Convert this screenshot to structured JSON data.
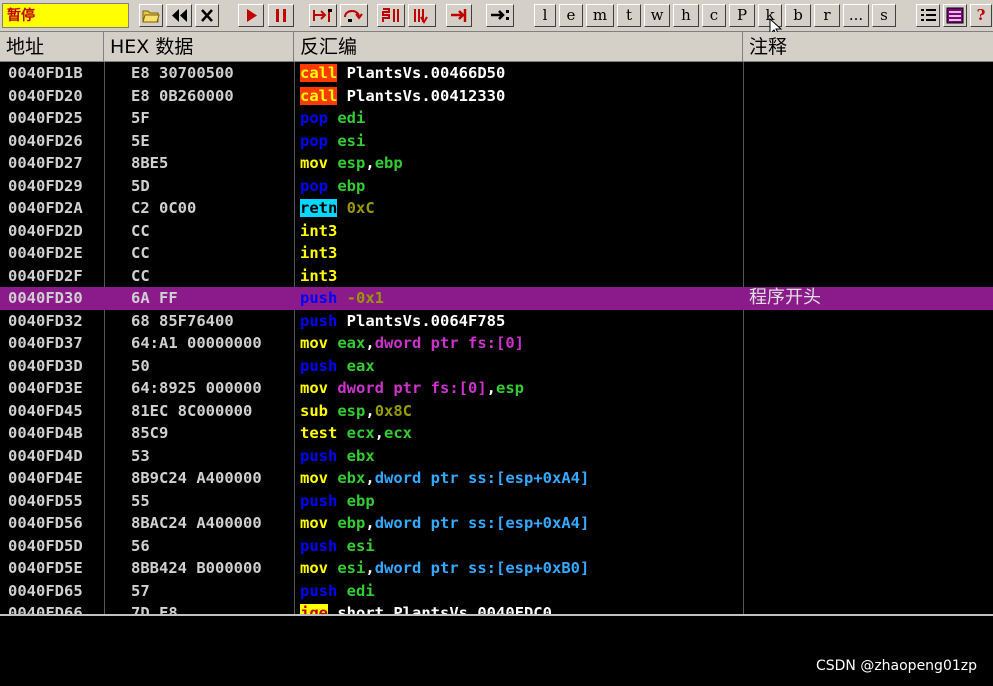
{
  "toolbar": {
    "status": "暂停",
    "letters": [
      "l",
      "e",
      "m",
      "t",
      "w",
      "h",
      "c",
      "P",
      "k",
      "b",
      "r",
      "...",
      "s"
    ],
    "help": "?"
  },
  "columns": {
    "address": "地址",
    "hex": "HEX 数据",
    "disasm": "反汇编",
    "comment": "注释"
  },
  "rows": [
    {
      "addr": "0040FD1B",
      "hex": "E8 30700500",
      "mn": "call",
      "mt": "call",
      "ops": [
        {
          "t": "PlantsVs.00466D50",
          "c": "white"
        }
      ]
    },
    {
      "addr": "0040FD20",
      "hex": "E8 0B260000",
      "mn": "call",
      "mt": "call",
      "ops": [
        {
          "t": "PlantsVs.00412330",
          "c": "white"
        }
      ]
    },
    {
      "addr": "0040FD25",
      "hex": "5F",
      "mn": "pop",
      "mt": "stack",
      "ops": [
        {
          "t": "edi",
          "c": "green"
        }
      ]
    },
    {
      "addr": "0040FD26",
      "hex": "5E",
      "mn": "pop",
      "mt": "stack",
      "ops": [
        {
          "t": "esi",
          "c": "green"
        }
      ]
    },
    {
      "addr": "0040FD27",
      "hex": "8BE5",
      "mn": "mov",
      "mt": "normal",
      "ops": [
        {
          "t": "esp",
          "c": "green"
        },
        {
          "t": ",",
          "c": "white"
        },
        {
          "t": "ebp",
          "c": "green"
        }
      ]
    },
    {
      "addr": "0040FD29",
      "hex": "5D",
      "mn": "pop",
      "mt": "stack",
      "ops": [
        {
          "t": "ebp",
          "c": "green"
        }
      ]
    },
    {
      "addr": "0040FD2A",
      "hex": "C2 0C00",
      "mn": "retn",
      "mt": "retn",
      "ops": [
        {
          "t": "0xC",
          "c": "num"
        }
      ]
    },
    {
      "addr": "0040FD2D",
      "hex": "CC",
      "mn": "int3",
      "mt": "normal",
      "ops": []
    },
    {
      "addr": "0040FD2E",
      "hex": "CC",
      "mn": "int3",
      "mt": "normal",
      "ops": []
    },
    {
      "addr": "0040FD2F",
      "hex": "CC",
      "mn": "int3",
      "mt": "normal",
      "ops": []
    },
    {
      "addr": "0040FD30",
      "hex": "6A FF",
      "mn": "push",
      "mt": "stack",
      "ops": [
        {
          "t": "-0x1",
          "c": "num"
        }
      ],
      "comment": "程序开头",
      "selected": true
    },
    {
      "addr": "0040FD32",
      "hex": "68 85F76400",
      "mn": "push",
      "mt": "stack",
      "ops": [
        {
          "t": "PlantsVs.0064F785",
          "c": "white"
        }
      ]
    },
    {
      "addr": "0040FD37",
      "hex": "64:A1 00000000",
      "mn": "mov",
      "mt": "normal",
      "ops": [
        {
          "t": "eax",
          "c": "green"
        },
        {
          "t": ",",
          "c": "white"
        },
        {
          "t": "dword ptr fs:[0]",
          "c": "mag"
        }
      ]
    },
    {
      "addr": "0040FD3D",
      "hex": "50",
      "mn": "push",
      "mt": "stack",
      "ops": [
        {
          "t": "eax",
          "c": "green"
        }
      ]
    },
    {
      "addr": "0040FD3E",
      "hex": "64:8925 000000",
      "mn": "mov",
      "mt": "normal",
      "ops": [
        {
          "t": "dword ptr fs:[0]",
          "c": "mag"
        },
        {
          "t": ",",
          "c": "white"
        },
        {
          "t": "esp",
          "c": "green"
        }
      ]
    },
    {
      "addr": "0040FD45",
      "hex": "81EC 8C000000",
      "mn": "sub",
      "mt": "normal",
      "ops": [
        {
          "t": "esp",
          "c": "green"
        },
        {
          "t": ",",
          "c": "white"
        },
        {
          "t": "0x8C",
          "c": "num"
        }
      ]
    },
    {
      "addr": "0040FD4B",
      "hex": "85C9",
      "mn": "test",
      "mt": "normal",
      "ops": [
        {
          "t": "ecx",
          "c": "green"
        },
        {
          "t": ",",
          "c": "white"
        },
        {
          "t": "ecx",
          "c": "green"
        }
      ]
    },
    {
      "addr": "0040FD4D",
      "hex": "53",
      "mn": "push",
      "mt": "stack",
      "ops": [
        {
          "t": "ebx",
          "c": "green"
        }
      ]
    },
    {
      "addr": "0040FD4E",
      "hex": "8B9C24 A400000",
      "mn": "mov",
      "mt": "normal",
      "ops": [
        {
          "t": "ebx",
          "c": "green"
        },
        {
          "t": ",",
          "c": "white"
        },
        {
          "t": "dword ptr ss:[esp+0xA4]",
          "c": "cyan"
        }
      ]
    },
    {
      "addr": "0040FD55",
      "hex": "55",
      "mn": "push",
      "mt": "stack",
      "ops": [
        {
          "t": "ebp",
          "c": "green"
        }
      ]
    },
    {
      "addr": "0040FD56",
      "hex": "8BAC24 A400000",
      "mn": "mov",
      "mt": "normal",
      "ops": [
        {
          "t": "ebp",
          "c": "green"
        },
        {
          "t": ",",
          "c": "white"
        },
        {
          "t": "dword ptr ss:[esp+0xA4]",
          "c": "cyan"
        }
      ]
    },
    {
      "addr": "0040FD5D",
      "hex": "56",
      "mn": "push",
      "mt": "stack",
      "ops": [
        {
          "t": "esi",
          "c": "green"
        }
      ]
    },
    {
      "addr": "0040FD5E",
      "hex": "8BB424 B000000",
      "mn": "mov",
      "mt": "normal",
      "ops": [
        {
          "t": "esi",
          "c": "green"
        },
        {
          "t": ",",
          "c": "white"
        },
        {
          "t": "dword ptr ss:[esp+0xB0]",
          "c": "cyan"
        }
      ]
    },
    {
      "addr": "0040FD65",
      "hex": "57",
      "mn": "push",
      "mt": "stack",
      "ops": [
        {
          "t": "edi",
          "c": "green"
        }
      ]
    },
    {
      "addr": "0040FD66",
      "hex": "7D F8",
      "mn": "jge",
      "mt": "jmp",
      "ops": [
        {
          "t": "short PlantsVs.0040FDC0",
          "c": "white"
        }
      ]
    }
  ],
  "watermark": "CSDN @zhaopeng01zp",
  "colors": {
    "selection": "#8b1a8b",
    "status_bg": "#ffff00",
    "toolbar_bg": "#d4d0c8"
  }
}
